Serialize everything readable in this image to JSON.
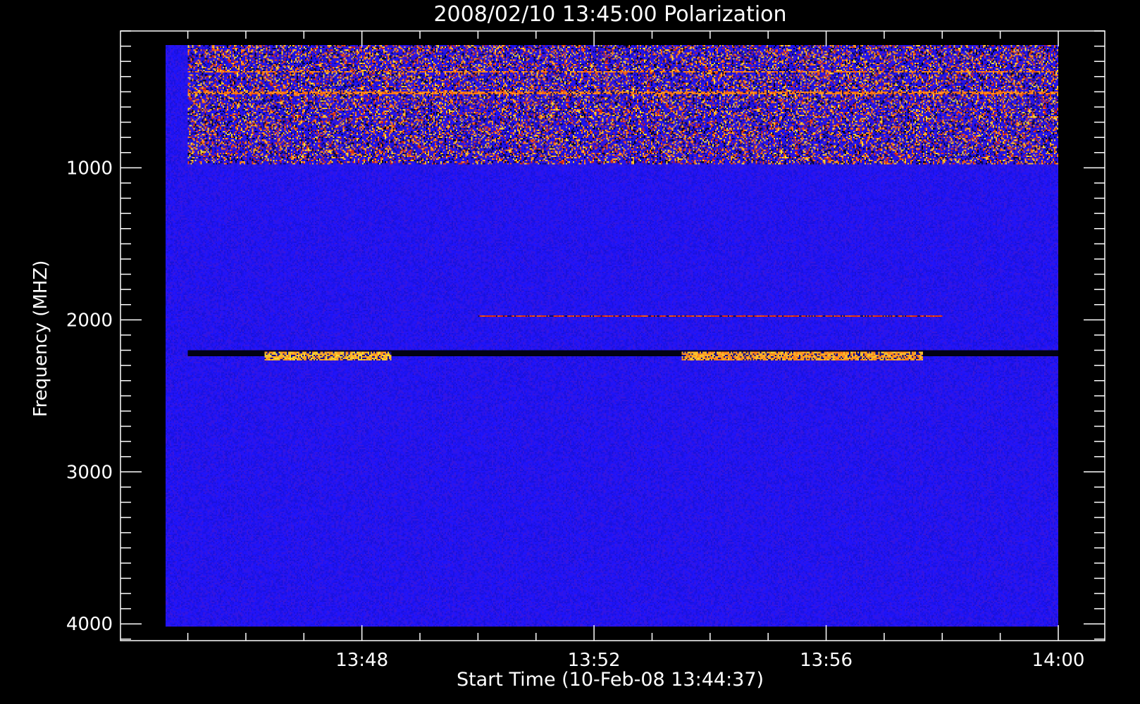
{
  "chart_data": {
    "type": "heatmap",
    "title": "2008/02/10 13:45:00 Polarization",
    "xlabel": "Start Time (10-Feb-08 13:44:37)",
    "ylabel": "Frequency (MHZ)",
    "x_major_ticks": [
      {
        "value": "13:48",
        "label": "13:48"
      },
      {
        "value": "13:52",
        "label": "13:52"
      },
      {
        "value": "13:56",
        "label": "13:56"
      },
      {
        "value": "14:00",
        "label": "14:00"
      }
    ],
    "x_minor_step_seconds": 60,
    "x_range": [
      "13:44:37",
      "14:00:00"
    ],
    "y_major_ticks": [
      1000,
      2000,
      3000,
      4000
    ],
    "y_minor_step": 100,
    "y_range": [
      4110,
      100
    ],
    "data_y_range": [
      4000,
      100
    ],
    "y_inverted": true,
    "colormap": [
      "#000000",
      "#1e14ff",
      "#d81e0a",
      "#ff9020",
      "#f0ff40"
    ],
    "background_value": 0.25,
    "features": [
      {
        "name": "noisy band",
        "freq_range": [
          100,
          900
        ],
        "time_range": [
          "13:45",
          "14:00"
        ],
        "intensity": "mixed 0.0–1.0"
      },
      {
        "name": "bright line",
        "freq": 280,
        "time_range": [
          "13:45",
          "14:00"
        ],
        "intensity": 0.8
      },
      {
        "name": "bright line",
        "freq": 420,
        "time_range": [
          "13:45",
          "14:00"
        ],
        "intensity": 0.8
      },
      {
        "name": "weak emission",
        "freq": 1920,
        "time_range": [
          "13:50",
          "13:58"
        ],
        "intensity": 0.65
      },
      {
        "name": "dark line",
        "freq_range": [
          2150,
          2190
        ],
        "time_range": [
          "13:45",
          "14:00"
        ],
        "intensity": 0.0
      },
      {
        "name": "strong emission",
        "freq_range": [
          2160,
          2220
        ],
        "time_range": [
          "13:46:20",
          "13:48:30"
        ],
        "intensity": 0.95
      },
      {
        "name": "strong emission",
        "freq_range": [
          2160,
          2220
        ],
        "time_range": [
          "13:53:30",
          "13:57:40"
        ],
        "intensity": 0.9
      }
    ]
  }
}
